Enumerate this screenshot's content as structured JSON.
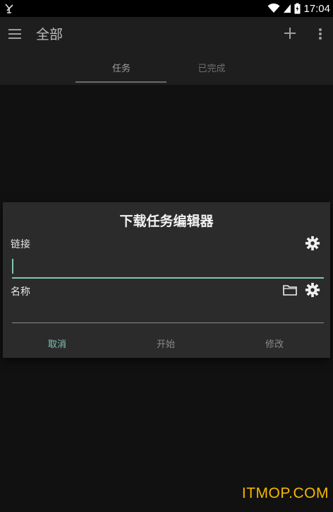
{
  "status_bar": {
    "time": "17:04"
  },
  "app_bar": {
    "title": "全部"
  },
  "tabs": [
    {
      "label": "任务"
    },
    {
      "label": "已完成"
    }
  ],
  "dialog": {
    "title": "下载任务编辑器",
    "link_label": "链接",
    "link_value": "",
    "name_label": "名称",
    "name_value": "",
    "buttons": {
      "cancel": "取消",
      "start": "开始",
      "modify": "修改"
    }
  },
  "watermark": "ITMOP.COM",
  "colors": {
    "accent": "#7fc7b6",
    "watermark": "#f5b800"
  }
}
